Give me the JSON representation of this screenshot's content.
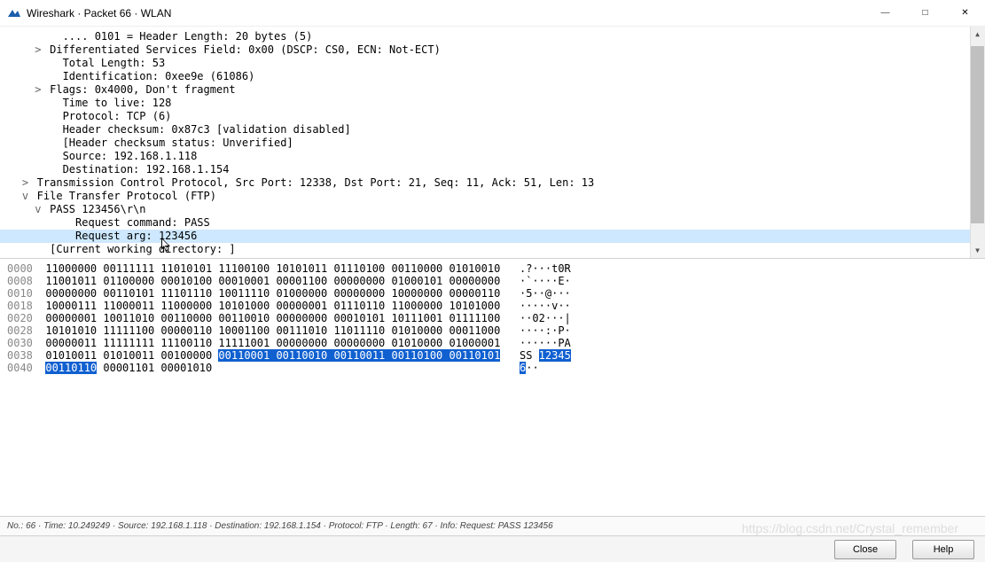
{
  "window": {
    "title": "Wireshark · Packet 66 · WLAN"
  },
  "detail_lines": [
    {
      "indent": 3,
      "exp": "",
      "text": ".... 0101 = Header Length: 20 bytes (5)",
      "sel": false
    },
    {
      "indent": 2,
      "exp": ">",
      "text": "Differentiated Services Field: 0x00 (DSCP: CS0, ECN: Not-ECT)",
      "sel": false
    },
    {
      "indent": 3,
      "exp": "",
      "text": "Total Length: 53",
      "sel": false
    },
    {
      "indent": 3,
      "exp": "",
      "text": "Identification: 0xee9e (61086)",
      "sel": false
    },
    {
      "indent": 2,
      "exp": ">",
      "text": "Flags: 0x4000, Don't fragment",
      "sel": false
    },
    {
      "indent": 3,
      "exp": "",
      "text": "Time to live: 128",
      "sel": false
    },
    {
      "indent": 3,
      "exp": "",
      "text": "Protocol: TCP (6)",
      "sel": false
    },
    {
      "indent": 3,
      "exp": "",
      "text": "Header checksum: 0x87c3 [validation disabled]",
      "sel": false
    },
    {
      "indent": 3,
      "exp": "",
      "text": "[Header checksum status: Unverified]",
      "sel": false
    },
    {
      "indent": 3,
      "exp": "",
      "text": "Source: 192.168.1.118",
      "sel": false
    },
    {
      "indent": 3,
      "exp": "",
      "text": "Destination: 192.168.1.154",
      "sel": false
    },
    {
      "indent": 1,
      "exp": ">",
      "text": "Transmission Control Protocol, Src Port: 12338, Dst Port: 21, Seq: 11, Ack: 51, Len: 13",
      "sel": false
    },
    {
      "indent": 1,
      "exp": "v",
      "text": "File Transfer Protocol (FTP)",
      "sel": false
    },
    {
      "indent": 2,
      "exp": "v",
      "text": "PASS 123456\\r\\n",
      "sel": false
    },
    {
      "indent": 4,
      "exp": "",
      "text": "Request command: PASS",
      "sel": false
    },
    {
      "indent": 4,
      "exp": "",
      "text": "Request arg: 123456",
      "sel": true
    },
    {
      "indent": 2,
      "exp": "",
      "text": "[Current working directory: ]",
      "sel": false
    }
  ],
  "hex_rows": [
    {
      "off": "0000",
      "bin": "11000000 00111111 11010101 11100100 10101011 01110100 00110000 01010010",
      "txt": ".?···t0R"
    },
    {
      "off": "0008",
      "bin": "11001011 01100000 00010100 00010001 00001100 00000000 01000101 00000000",
      "txt": "·`····E·"
    },
    {
      "off": "0010",
      "bin": "00000000 00110101 11101110 10011110 01000000 00000000 10000000 00000110",
      "txt": "·5··@···"
    },
    {
      "off": "0018",
      "bin": "10000111 11000011 11000000 10101000 00000001 01110110 11000000 10101000",
      "txt": "·····v··"
    },
    {
      "off": "0020",
      "bin": "00000001 10011010 00110000 00110010 00000000 00010101 10111001 01111100",
      "txt": "··02···|"
    },
    {
      "off": "0028",
      "bin": "10101010 11111100 00000110 10001100 00111010 11011110 01010000 00011000",
      "txt": "····:·P·"
    },
    {
      "off": "0030",
      "bin": "00000011 11111111 11100110 11111001 00000000 00000000 01010000 01000001",
      "txt": "······PA"
    },
    {
      "off": "0038",
      "bin_pre": "01010011 01010011 00100000 ",
      "bin_hl": "00110001 00110010 00110011 00110100 00110101",
      "txt_pre": "SS ",
      "txt_hl": "12345"
    },
    {
      "off": "0040",
      "bin_hl0": "00110110",
      "bin_post": " 00001101 00001010",
      "txt_hl0": "6",
      "txt_post": "··"
    }
  ],
  "status": "No.: 66 · Time: 10.249249 · Source: 192.168.1.118 · Destination: 192.168.1.154 · Protocol: FTP · Length: 67 · Info: Request: PASS 123456",
  "buttons": {
    "close": "Close",
    "help": "Help"
  },
  "watermark": "https://blog.csdn.net/Crystal_remember"
}
